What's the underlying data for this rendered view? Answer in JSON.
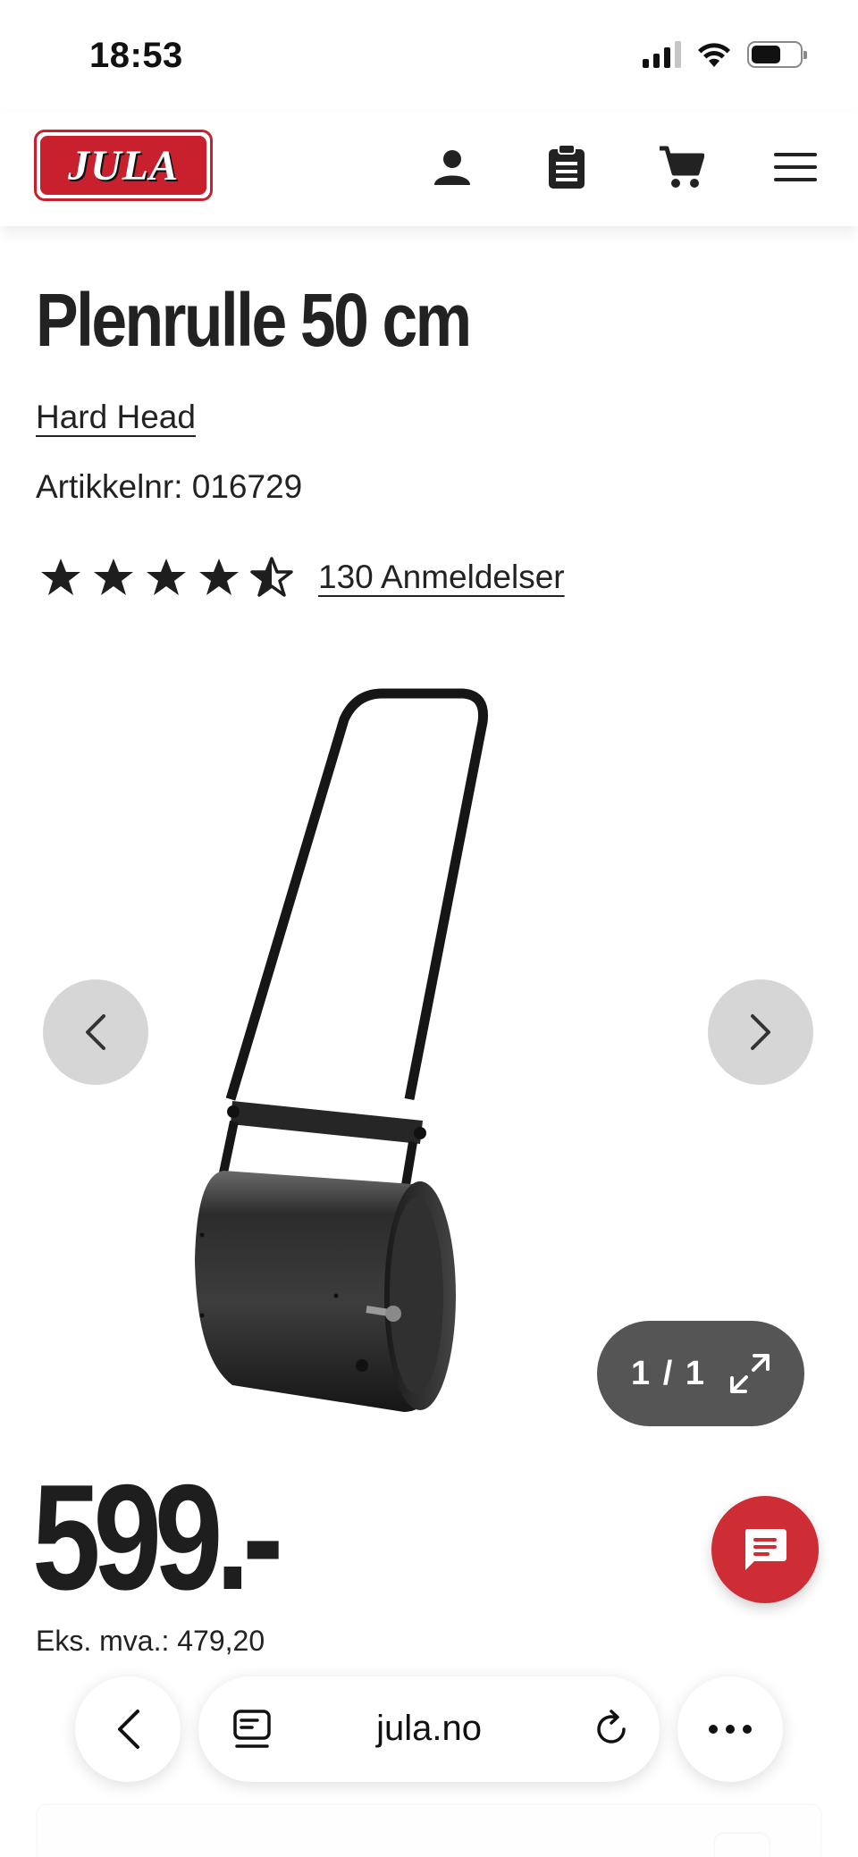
{
  "status_bar": {
    "time": "18:53"
  },
  "header": {
    "logo_text": "JULA",
    "icons": [
      "user-icon",
      "clipboard-list-icon",
      "cart-icon",
      "menu-icon"
    ]
  },
  "product": {
    "title": "Plenrulle 50 cm",
    "brand": "Hard Head",
    "article_label": "Artikkelnr: 016729",
    "rating": 4.5,
    "rating_max": 5,
    "reviews_label": "130 Anmeldelser",
    "price": "599.-",
    "price_ex_vat": "Eks. mva.: 479,20"
  },
  "gallery": {
    "counter": "1 / 1",
    "image_name": "lawn-roller-image"
  },
  "browser": {
    "url": "jula.no"
  },
  "colors": {
    "brand_red": "#c8202d",
    "chat_red": "#cf2d35",
    "arrow_grey": "#d6d6d6",
    "pill_grey": "#555555"
  }
}
